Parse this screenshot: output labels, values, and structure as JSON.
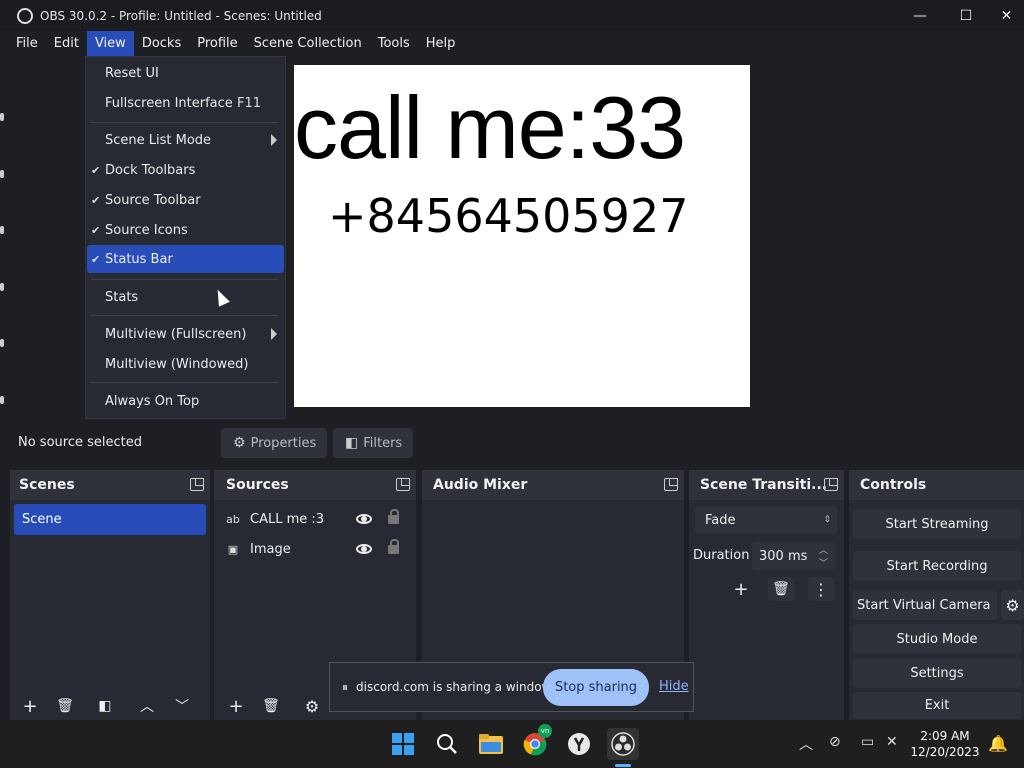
{
  "window": {
    "title": "OBS 30.0.2 - Profile: Untitled - Scenes: Untitled",
    "minimize": "—",
    "maximize": "☐",
    "close": "✕"
  },
  "menubar": [
    "File",
    "Edit",
    "View",
    "Docks",
    "Profile",
    "Scene Collection",
    "Tools",
    "Help"
  ],
  "view_menu": {
    "reset_ui": "Reset UI",
    "fullscreen": "Fullscreen Interface",
    "fullscreen_shortcut": "F11",
    "scene_list_mode": "Scene List Mode",
    "dock_toolbars": "Dock Toolbars",
    "source_toolbar": "Source Toolbar",
    "source_icons": "Source Icons",
    "status_bar": "Status Bar",
    "stats": "Stats",
    "multiview_full": "Multiview (Fullscreen)",
    "multiview_win": "Multiview (Windowed)",
    "always_on_top": "Always On Top",
    "check": "✔"
  },
  "preview": {
    "line1": "call me:33",
    "line2": "+84564505927"
  },
  "source_toolbar": {
    "no_source": "No source selected",
    "properties": "Properties",
    "filters": "Filters"
  },
  "docks": {
    "scenes": {
      "title": "Scenes",
      "items": [
        "Scene"
      ]
    },
    "sources": {
      "title": "Sources",
      "items": [
        {
          "icon": "ab",
          "name": "CALL me :3"
        },
        {
          "icon": "▣",
          "name": "Image"
        }
      ]
    },
    "audio_mixer": {
      "title": "Audio Mixer"
    },
    "transitions": {
      "title": "Scene Transiti...",
      "transition": "Fade",
      "duration_label": "Duration",
      "duration": "300 ms"
    },
    "controls": {
      "title": "Controls",
      "start_streaming": "Start Streaming",
      "start_recording": "Start Recording",
      "start_virtual": "Start Virtual Camera",
      "studio_mode": "Studio Mode",
      "settings": "Settings",
      "exit": "Exit"
    }
  },
  "share_bar": {
    "pause": "⏸",
    "message": "discord.com is sharing a window.",
    "stop": "Stop sharing",
    "hide": "Hide"
  },
  "taskbar": {
    "time": "2:09 AM",
    "date": "12/20/2023",
    "chrome_badge": "vn"
  }
}
